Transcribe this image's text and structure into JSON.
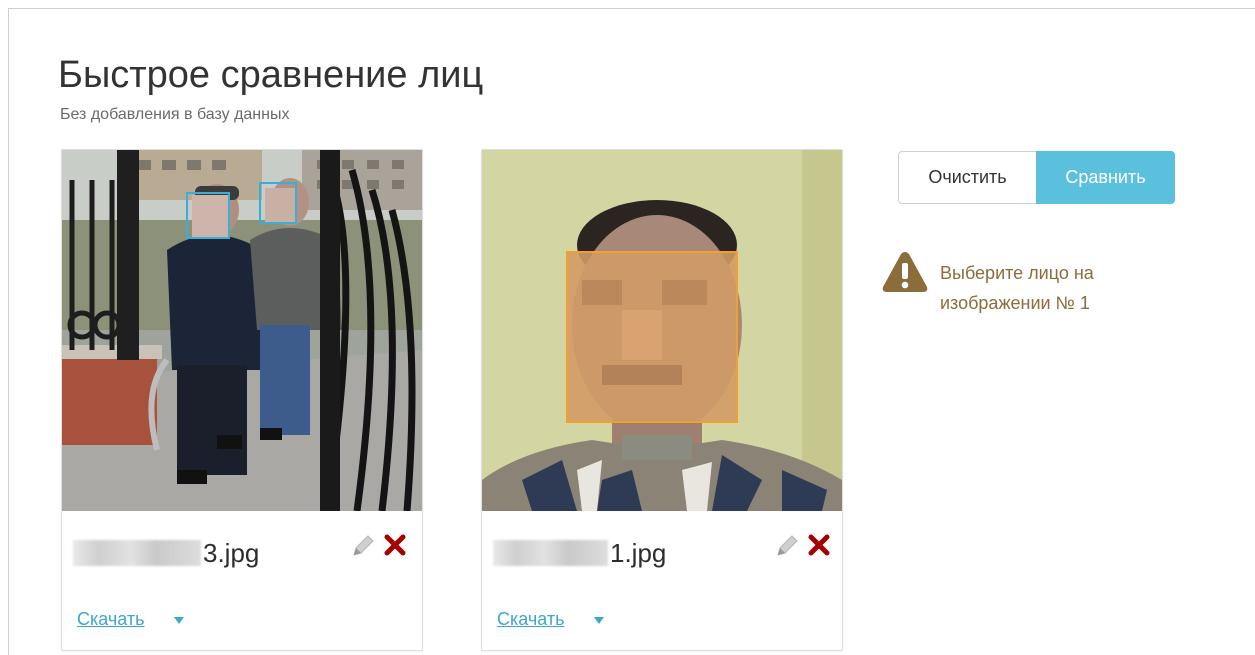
{
  "header": {
    "title": "Быстрое сравнение лиц",
    "subtitle": "Без добавления в базу данных"
  },
  "cards": [
    {
      "filename_suffix": "3.jpg",
      "download_label": "Скачать"
    },
    {
      "filename_suffix": "1.jpg",
      "download_label": "Скачать"
    }
  ],
  "actions": {
    "clear_label": "Очистить",
    "compare_label": "Сравнить"
  },
  "warning": {
    "icon": "warning-triangle-icon",
    "text": "Выберите лицо на изображении № 1"
  },
  "colors": {
    "accent": "#5bc0de",
    "link": "#3ea7c9",
    "warning": "#8a6d3b",
    "delete": "#a40000",
    "face_box_1": "#3aaed8",
    "face_box_2": "#f0a030"
  }
}
